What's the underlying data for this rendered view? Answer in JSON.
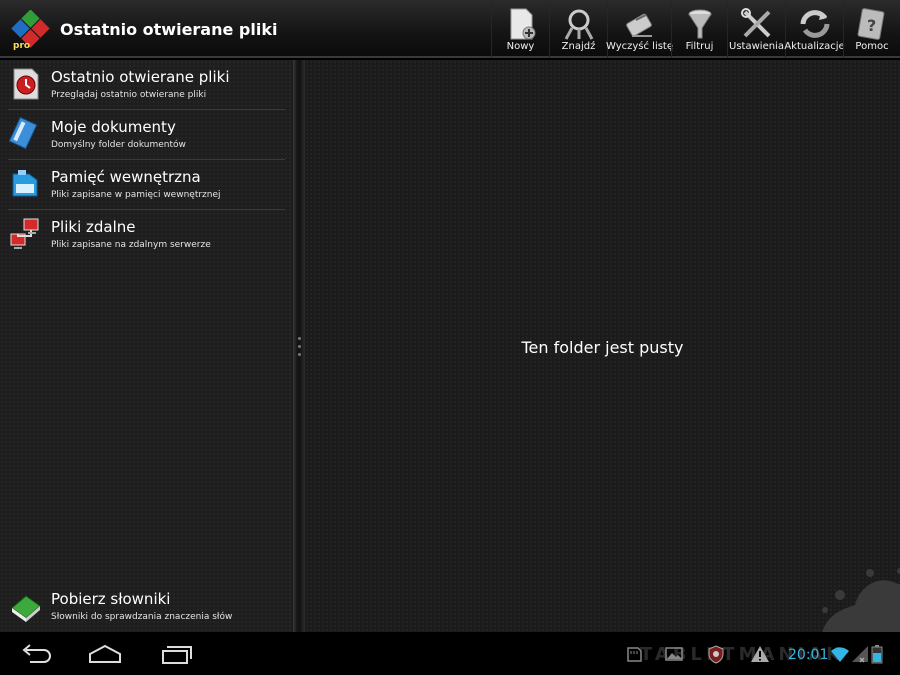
{
  "app": {
    "title": "Ostatnio otwierane pliki",
    "logo_text": "pro",
    "logo_icon": "office-suite-logo"
  },
  "actions": [
    {
      "label": "Nowy",
      "icon": "new-document-icon"
    },
    {
      "label": "Znajdź",
      "icon": "find-icon"
    },
    {
      "label": "Wyczyść listę",
      "icon": "clear-list-icon"
    },
    {
      "label": "Filtruj",
      "icon": "filter-icon"
    },
    {
      "label": "Ustawienia",
      "icon": "settings-tools-icon"
    },
    {
      "label": "Aktualizacje",
      "icon": "updates-icon"
    },
    {
      "label": "Pomoc",
      "icon": "help-icon"
    }
  ],
  "nav": {
    "items": [
      {
        "title": "Ostatnio otwierane pliki",
        "subtitle": "Przeglądaj ostatnio otwierane pliki",
        "icon": "recent-files-icon"
      },
      {
        "title": "Moje dokumenty",
        "subtitle": "Domyślny folder dokumentów",
        "icon": "my-documents-icon"
      },
      {
        "title": "Pamięć wewnętrzna",
        "subtitle": "Pliki zapisane w pamięci wewnętrznej",
        "icon": "internal-storage-icon"
      },
      {
        "title": "Pliki zdalne",
        "subtitle": "Pliki zapisane na zdalnym serwerze",
        "icon": "remote-files-icon"
      }
    ],
    "bottom": {
      "title": "Pobierz słowniki",
      "subtitle": "Słowniki do sprawdzania znaczenia słów",
      "icon": "dictionary-icon"
    }
  },
  "content": {
    "empty_message": "Ten folder jest pusty"
  },
  "system_bar": {
    "clock": "20:01",
    "watermark": "TABLETMANIAK",
    "accent_color": "#33b5e5",
    "icons": [
      "back-icon",
      "home-icon",
      "recent-apps-icon",
      "sd-card-icon",
      "gallery-icon",
      "antivirus-icon",
      "warning-icon",
      "wifi-icon",
      "signal-icon",
      "battery-icon"
    ]
  }
}
